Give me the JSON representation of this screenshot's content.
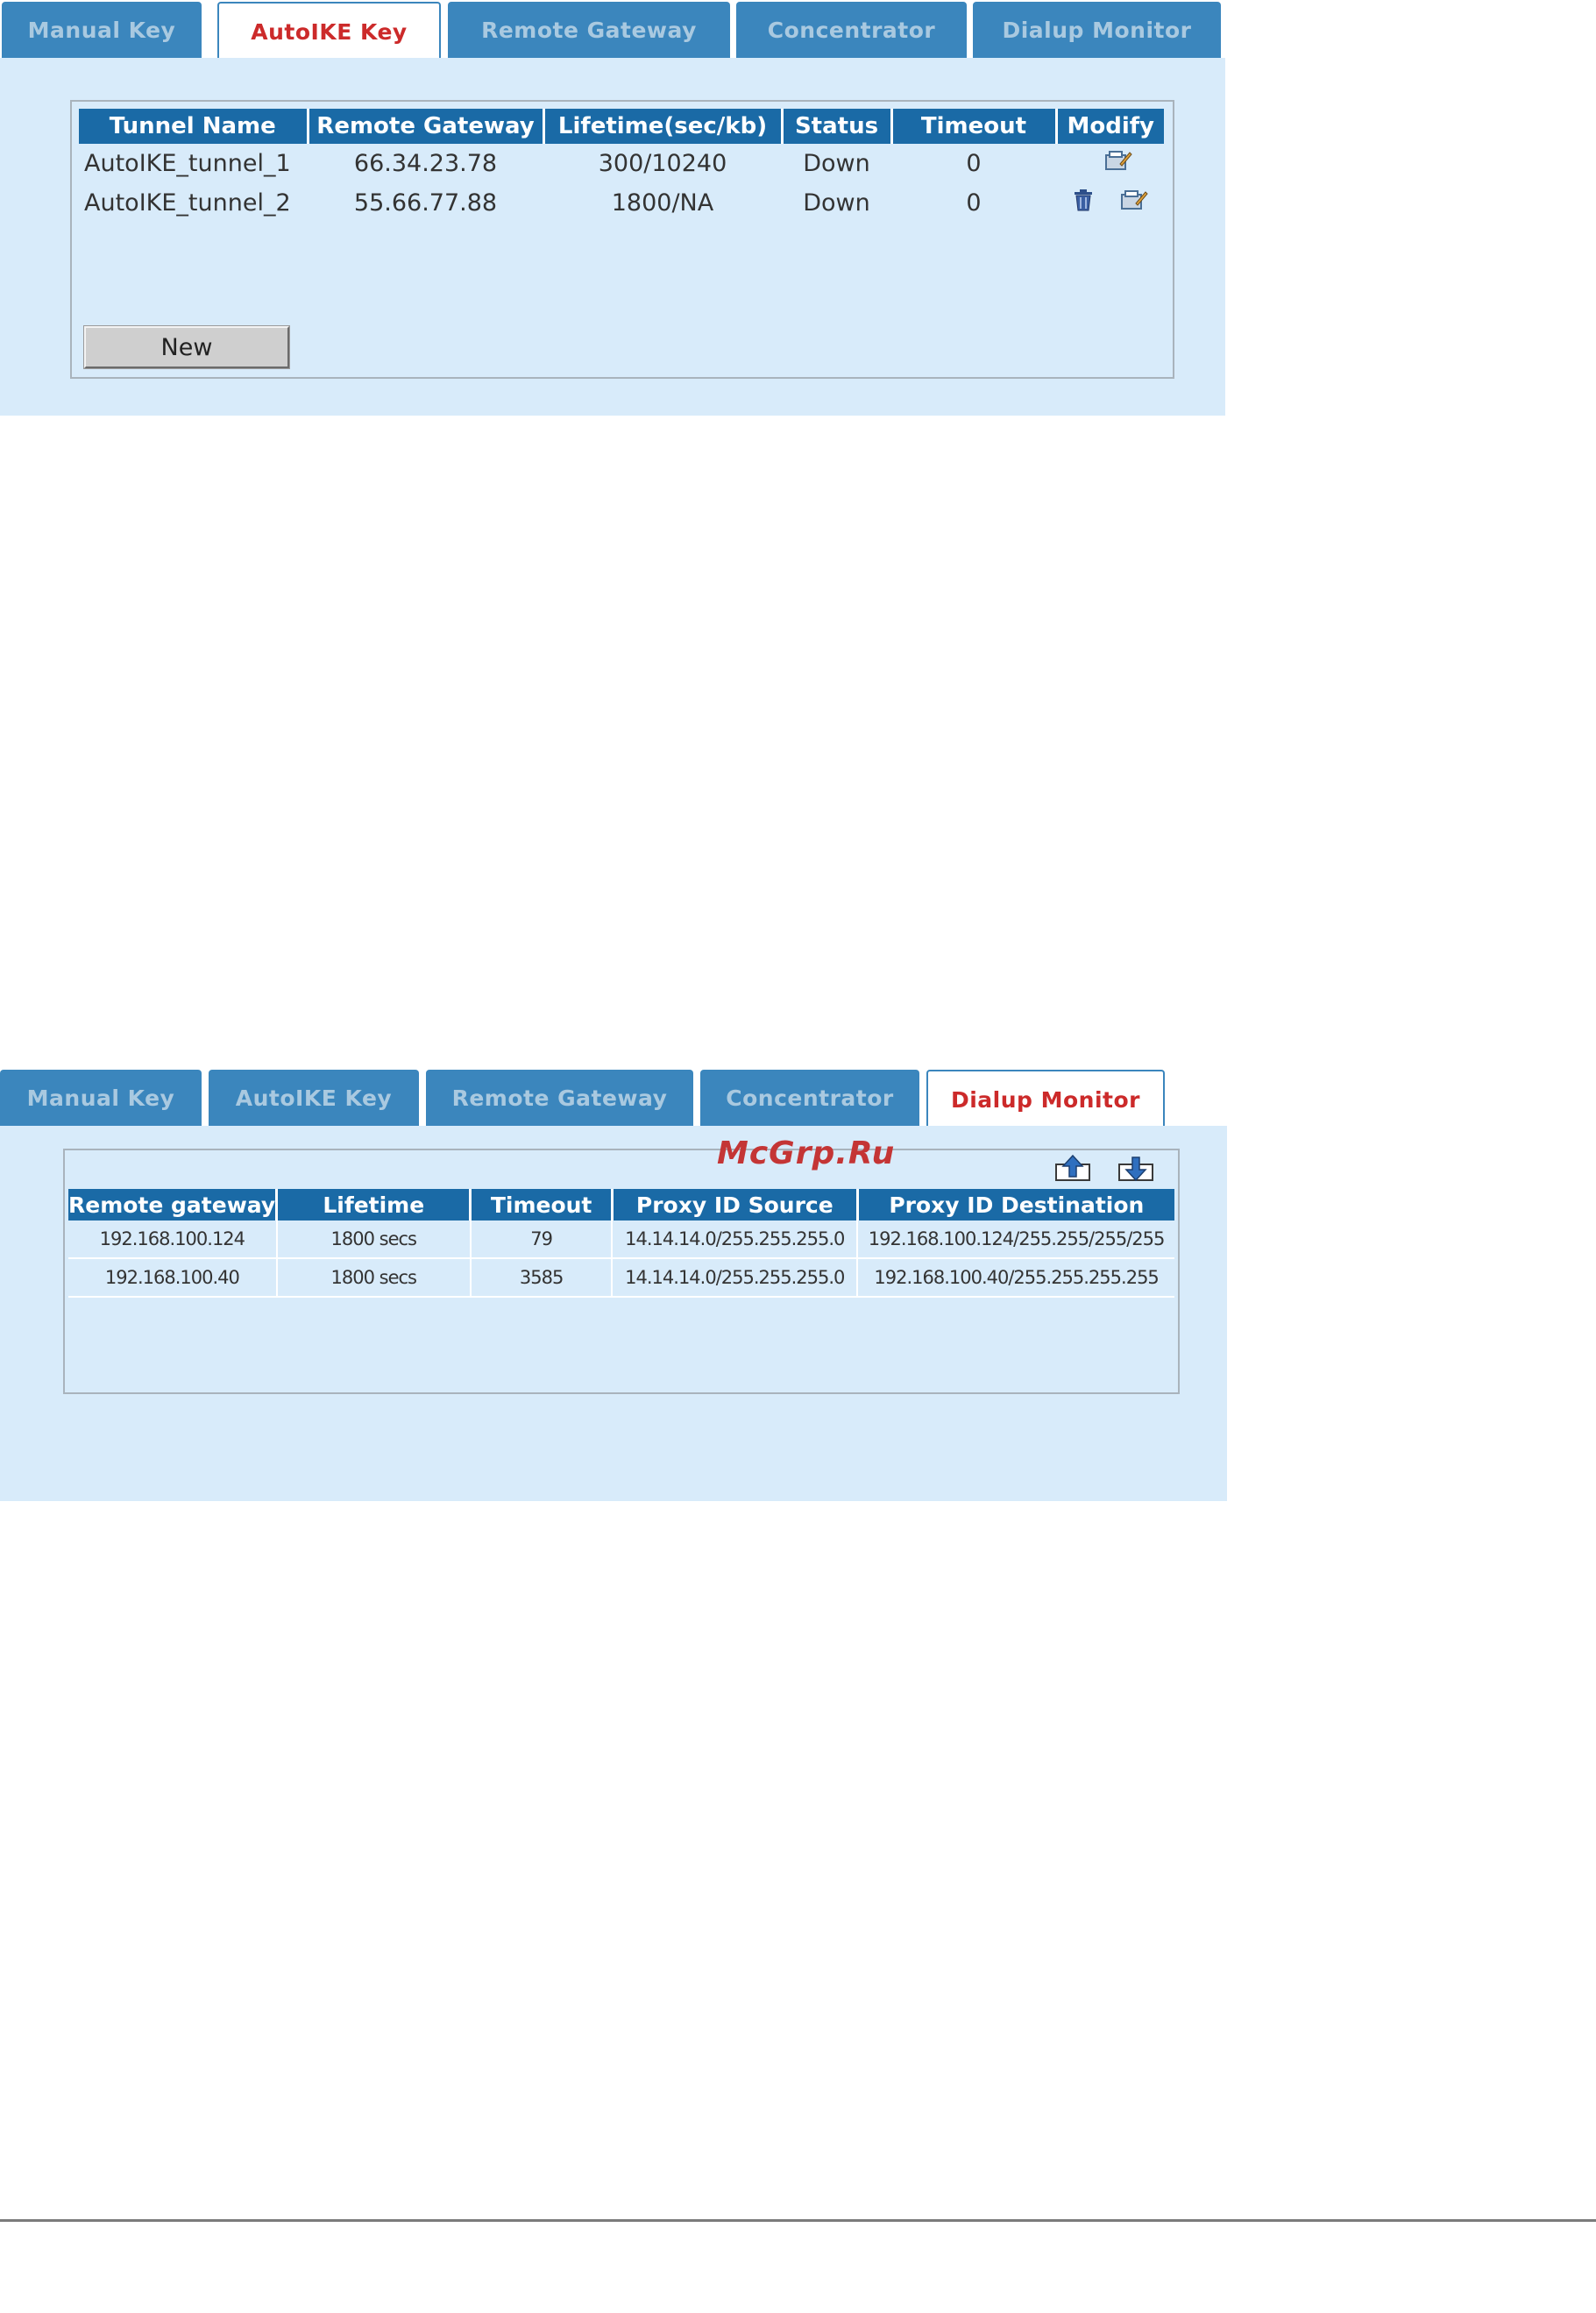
{
  "panel1": {
    "tabs": [
      {
        "label": "Manual Key",
        "active": false
      },
      {
        "label": "AutoIKE Key",
        "active": true
      },
      {
        "label": "Remote Gateway",
        "active": false
      },
      {
        "label": "Concentrator",
        "active": false
      },
      {
        "label": "Dialup Monitor",
        "active": false
      }
    ],
    "table": {
      "headers": [
        "Tunnel Name",
        "Remote Gateway",
        "Lifetime(sec/kb)",
        "Status",
        "Timeout",
        "Modify"
      ],
      "rows": [
        {
          "name": "AutoIKE_tunnel_1",
          "gateway": "66.34.23.78",
          "lifetime": "300/10240",
          "status": "Down",
          "timeout": "0",
          "actions": [
            "edit-icon"
          ]
        },
        {
          "name": "AutoIKE_tunnel_2",
          "gateway": "55.66.77.88",
          "lifetime": "1800/NA",
          "status": "Down",
          "timeout": "0",
          "actions": [
            "delete-icon",
            "edit-icon"
          ]
        }
      ]
    },
    "new_button": "New"
  },
  "panel2": {
    "tabs": [
      {
        "label": "Manual Key",
        "active": false
      },
      {
        "label": "AutoIKE Key",
        "active": false
      },
      {
        "label": "Remote Gateway",
        "active": false
      },
      {
        "label": "Concentrator",
        "active": false
      },
      {
        "label": "Dialup Monitor",
        "active": true
      }
    ],
    "toolbar_icons": [
      "upload-icon",
      "download-icon"
    ],
    "table": {
      "headers": [
        "Remote gateway",
        "Lifetime",
        "Timeout",
        "Proxy ID Source",
        "Proxy ID Destination"
      ],
      "rows": [
        {
          "gateway": "192.168.100.124",
          "lifetime": "1800 secs",
          "timeout": "79",
          "source": "14.14.14.0/255.255.255.0",
          "destination": "192.168.100.124/255.255/255/255"
        },
        {
          "gateway": "192.168.100.40",
          "lifetime": "1800 secs",
          "timeout": "3585",
          "source": "14.14.14.0/255.255.255.0",
          "destination": "192.168.100.40/255.255.255.255"
        }
      ]
    }
  },
  "watermark": "McGrp.Ru",
  "colors": {
    "tab_bg": "#3b86bd",
    "tab_text": "#a9c9e0",
    "active_tab_text": "#cc2a2a",
    "panel_bg": "#d8ebfa",
    "header_bg": "#1a6aa6"
  }
}
